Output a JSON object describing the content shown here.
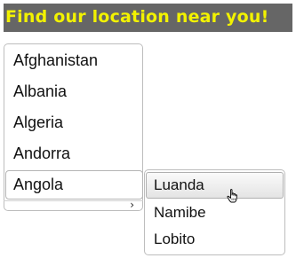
{
  "banner": {
    "title": "Find our location near you!",
    "background_color": "#666666",
    "text_color": "#f2f200"
  },
  "countries": {
    "items": [
      "Afghanistan",
      "Albania",
      "Algeria",
      "Andorra",
      "Angola"
    ],
    "selected": "Angola"
  },
  "cities": {
    "items": [
      "Luanda",
      "Namibe",
      "Lobito"
    ],
    "hovered": "Luanda"
  },
  "scrollbar": {
    "arrow_icon": "chevron-right-icon"
  },
  "cursor": {
    "icon": "hand-pointer-icon"
  }
}
